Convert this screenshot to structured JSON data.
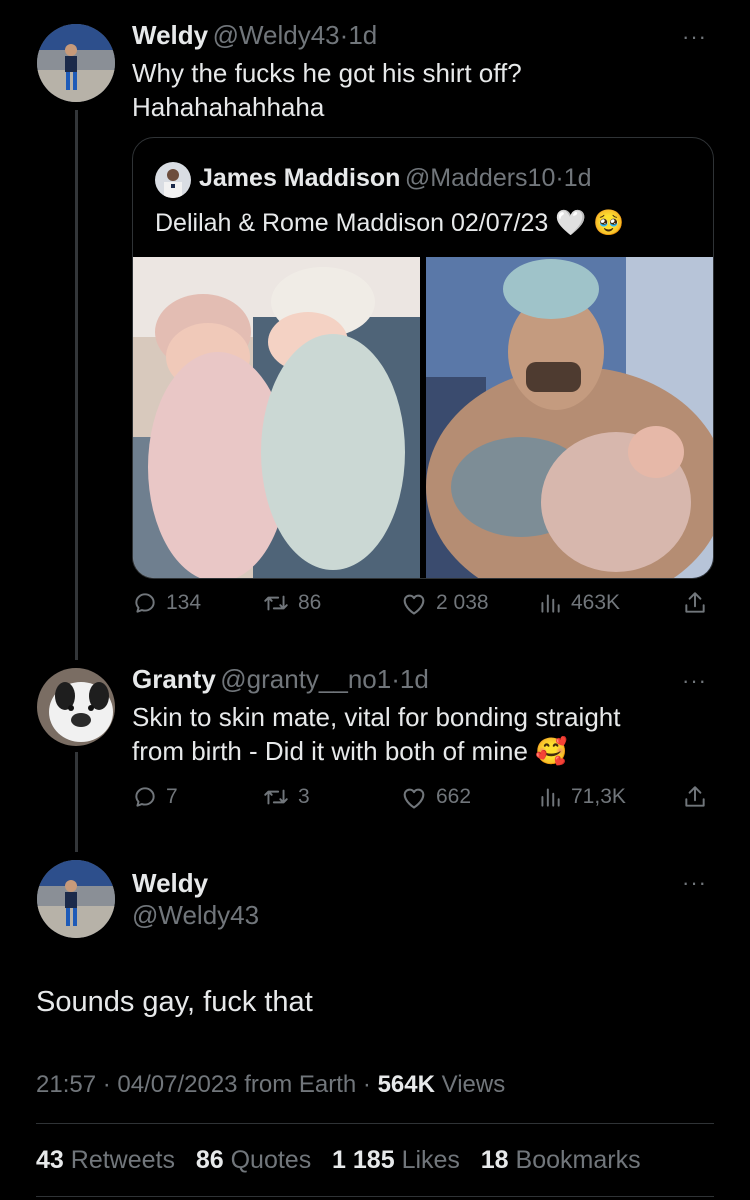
{
  "tweet1": {
    "name": "Weldy",
    "handle": "@Weldy43",
    "sep": "·",
    "time": "1d",
    "text_line1": "Why the fucks he got his shirt off?",
    "text_line2": "Hahahahahhaha",
    "more": "···"
  },
  "quote": {
    "name": "James Maddison",
    "handle": "@Madders10",
    "sep": "·",
    "time": "1d",
    "text": "Delilah & Rome Maddison 02/07/23 🤍 🥹"
  },
  "tweet1_actions": {
    "replies": "134",
    "retweets": "86",
    "likes": "2 038",
    "views": "463K"
  },
  "tweet2": {
    "name": "Granty",
    "handle": "@granty__no1",
    "sep": "·",
    "time": "1d",
    "text_line1": "Skin to skin mate, vital for bonding straight",
    "text_line2": "from birth - Did it with both of mine 🥰",
    "more": "···"
  },
  "tweet2_actions": {
    "replies": "7",
    "retweets": "3",
    "likes": "662",
    "views": "71,3K"
  },
  "main": {
    "name": "Weldy",
    "handle": "@Weldy43",
    "more": "···",
    "text": "Sounds gay, fuck that",
    "time": "21:57",
    "date": "04/07/2023",
    "source": "from Earth",
    "views_count": "564K",
    "views_label": "Views",
    "dot": "·"
  },
  "stats": {
    "retweets_count": "43",
    "retweets_label": "Retweets",
    "quotes_count": "86",
    "quotes_label": "Quotes",
    "likes_count": "1 185",
    "likes_label": "Likes",
    "bookmarks_count": "18",
    "bookmarks_label": "Bookmarks"
  },
  "colors": {
    "background": "#000000",
    "text": "#e7e9ea",
    "muted": "#71767b",
    "border": "#2f3336"
  }
}
